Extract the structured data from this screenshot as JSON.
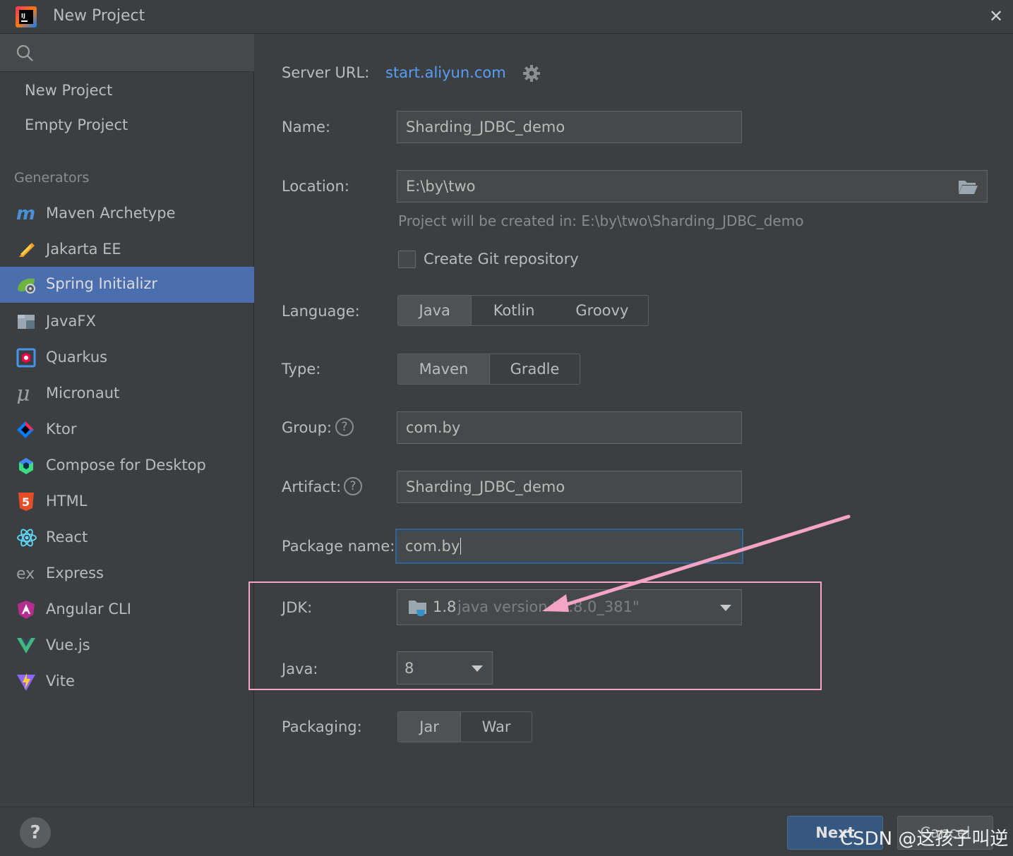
{
  "window": {
    "title": "New Project",
    "close_glyph": "✕"
  },
  "sidebar": {
    "top_items": [
      "New Project",
      "Empty Project"
    ],
    "section_label": "Generators",
    "generators": [
      {
        "label": "Maven Archetype",
        "icon": "maven-icon"
      },
      {
        "label": "Jakarta EE",
        "icon": "jakarta-ee-icon"
      },
      {
        "label": "Spring Initializr",
        "icon": "spring-icon",
        "selected": true
      },
      {
        "label": "JavaFX",
        "icon": "javafx-icon"
      },
      {
        "label": "Quarkus",
        "icon": "quarkus-icon"
      },
      {
        "label": "Micronaut",
        "icon": "micronaut-icon"
      },
      {
        "label": "Ktor",
        "icon": "ktor-icon"
      },
      {
        "label": "Compose for Desktop",
        "icon": "compose-icon"
      },
      {
        "label": "HTML",
        "icon": "html5-icon"
      },
      {
        "label": "React",
        "icon": "react-icon"
      },
      {
        "label": "Express",
        "icon": "express-icon"
      },
      {
        "label": "Angular CLI",
        "icon": "angular-icon"
      },
      {
        "label": "Vue.js",
        "icon": "vue-icon"
      },
      {
        "label": "Vite",
        "icon": "vite-icon"
      }
    ]
  },
  "form": {
    "server_url_label": "Server URL:",
    "server_url": "start.aliyun.com",
    "name_label": "Name:",
    "name_value": "Sharding_JDBC_demo",
    "location_label": "Location:",
    "location_value": "E:\\by\\two",
    "location_hint": "Project will be created in: E:\\by\\two\\Sharding_JDBC_demo",
    "git_label": "Create Git repository",
    "git_checked": false,
    "language_label": "Language:",
    "language_options": [
      "Java",
      "Kotlin",
      "Groovy"
    ],
    "language_selected": "Java",
    "type_label": "Type:",
    "type_options": [
      "Maven",
      "Gradle"
    ],
    "type_selected": "Maven",
    "group_label": "Group:",
    "group_value": "com.by",
    "artifact_label": "Artifact:",
    "artifact_value": "Sharding_JDBC_demo",
    "package_label": "Package name:",
    "package_value": "com.by",
    "jdk_label": "JDK:",
    "jdk_version": "1.8",
    "jdk_detail": "java version \"1.8.0_381\"",
    "java_label": "Java:",
    "java_value": "8",
    "packaging_label": "Packaging:",
    "packaging_options": [
      "Jar",
      "War"
    ],
    "packaging_selected": "Jar"
  },
  "footer": {
    "help": "?",
    "next_label": "Next",
    "cancel_label": "Cancel"
  },
  "watermark": "CSDN @这孩子叫逆",
  "colors": {
    "accent": "#4b6eaf",
    "link": "#589df6",
    "annotation": "#f5a3c7"
  }
}
